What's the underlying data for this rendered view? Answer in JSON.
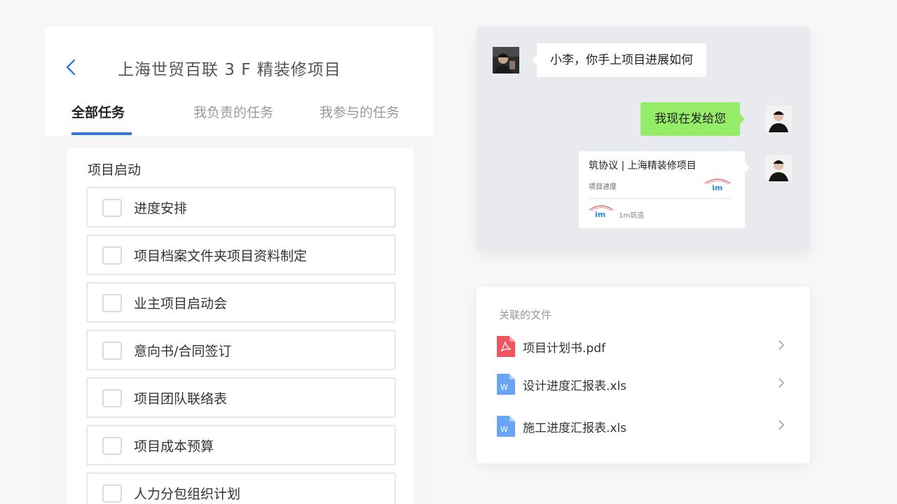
{
  "header": {
    "title": "上海世贸百联 3 F 精装修项目",
    "back_icon": "chevron-left-icon",
    "accent_color": "#2f7ae5"
  },
  "tabs": [
    {
      "label": "全部任务",
      "active": true
    },
    {
      "label": "我负责的任务",
      "active": false
    },
    {
      "label": "我参与的任务",
      "active": false
    }
  ],
  "task_section": {
    "title": "项目启动",
    "tasks": [
      {
        "label": "进度安排",
        "checked": false
      },
      {
        "label": "项目档案文件夹项目资料制定",
        "checked": false
      },
      {
        "label": "业主项目启动会",
        "checked": false
      },
      {
        "label": "意向书/合同签订",
        "checked": false
      },
      {
        "label": "项目团队联络表",
        "checked": false
      },
      {
        "label": "项目成本预算",
        "checked": false
      },
      {
        "label": "人力分包组织计划",
        "checked": false
      }
    ]
  },
  "chat": {
    "messages": [
      {
        "side": "left",
        "text": "小李，你手上项目进展如何"
      },
      {
        "side": "right",
        "text": "我现在发给您",
        "color": "#95ec69"
      }
    ],
    "link_card": {
      "title": "筑协议 | 上海精装修项目",
      "subtitle": "项目进度",
      "source": "1m筑造"
    }
  },
  "files": {
    "title": "关联的文件",
    "items": [
      {
        "name": "项目计划书.pdf",
        "icon": "pdf-file-icon",
        "color": "#f0555f"
      },
      {
        "name": "设计进度汇报表.xls",
        "icon": "word-file-icon",
        "color": "#6aa4f4"
      },
      {
        "name": "施工进度汇报表.xls",
        "icon": "word-file-icon",
        "color": "#6aa4f4"
      }
    ]
  }
}
